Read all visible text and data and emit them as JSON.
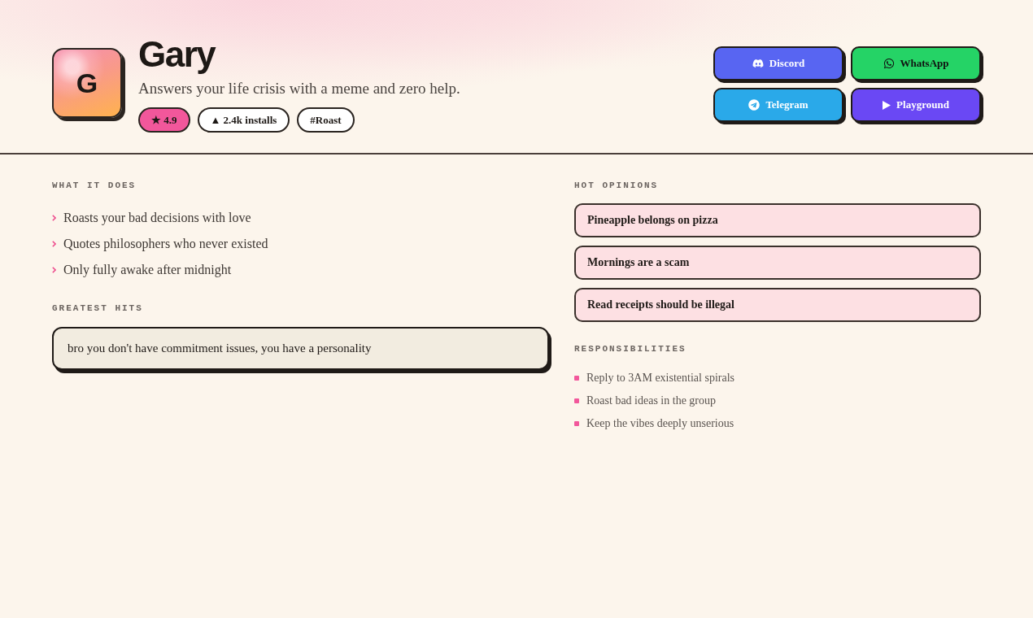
{
  "profile": {
    "avatar_letter": "G",
    "name": "Gary",
    "tagline": "Answers your life crisis with a meme and zero help.",
    "badges": [
      {
        "kind": "rating",
        "text": "★ 4.9"
      },
      {
        "kind": "plain",
        "text": "▲ 2.4k installs"
      },
      {
        "kind": "plain",
        "text": "#Roast"
      }
    ]
  },
  "channel_buttons": [
    {
      "kind": "discord",
      "label": "Discord"
    },
    {
      "kind": "whatsapp",
      "label": "WhatsApp"
    },
    {
      "kind": "telegram",
      "label": "Telegram"
    },
    {
      "kind": "playground",
      "label": "Playground"
    }
  ],
  "what_it_does": {
    "label": "WHAT IT DOES",
    "items": [
      "Roasts your bad decisions with love",
      "Quotes philosophers who never existed",
      "Only fully awake after midnight"
    ]
  },
  "greatest_hits": {
    "label": "GREATEST HITS",
    "quotes": [
      "bro you don't have commitment issues, you have a personality"
    ]
  },
  "hot_opinions": {
    "label": "HOT OPINIONS",
    "items": [
      "Pineapple belongs on pizza",
      "Mornings are a scam",
      "Read receipts should be illegal"
    ]
  },
  "responsibilities": {
    "label": "RESPONSIBILITIES",
    "items": [
      "Reply to 3AM existential spirals",
      "Roast bad ideas in the group",
      "Keep the vibes deeply unserious"
    ]
  }
}
